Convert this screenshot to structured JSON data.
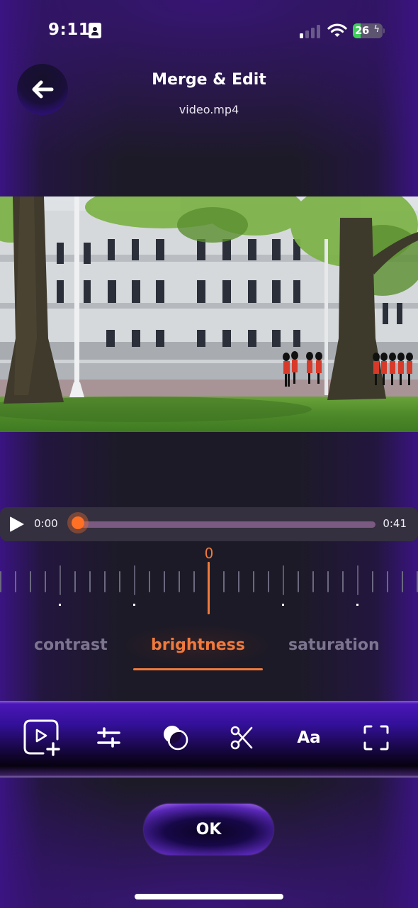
{
  "status_bar": {
    "time": "9:11",
    "battery_percent": "26",
    "battery_charging_icon": "bolt-icon",
    "signal_bars_active": 1,
    "signal_bars_total": 4
  },
  "header": {
    "back_icon": "arrow-left-icon",
    "title": "Merge & Edit",
    "subtitle": "video.mp4"
  },
  "video": {
    "description": "Video frame: white stone building behind trees, guards in red uniforms on the road, green lawn in foreground"
  },
  "player": {
    "play_icon": "play-icon",
    "current_time": "0:00",
    "total_time": "0:41",
    "progress": 0.0
  },
  "adjust_ruler": {
    "value": "0"
  },
  "adjust_tabs": [
    {
      "label": "contrast",
      "active": false
    },
    {
      "label": "brightness",
      "active": true
    },
    {
      "label": "saturation",
      "active": false
    }
  ],
  "toolbar": {
    "tools": [
      {
        "name": "add-video",
        "icon": "video-add-icon",
        "label": ""
      },
      {
        "name": "adjust",
        "icon": "sliders-icon",
        "label": ""
      },
      {
        "name": "filter",
        "icon": "overlap-circles-icon",
        "label": ""
      },
      {
        "name": "cut",
        "icon": "scissors-icon",
        "label": ""
      },
      {
        "name": "text",
        "icon": "text-icon",
        "label": "Aa"
      },
      {
        "name": "crop",
        "icon": "crop-frame-icon",
        "label": ""
      }
    ]
  },
  "ok_button": {
    "label": "OK"
  },
  "colors": {
    "accent_orange": "#f07a3c",
    "brand_purple": "#4a16b8",
    "background": "#1c1a26"
  }
}
